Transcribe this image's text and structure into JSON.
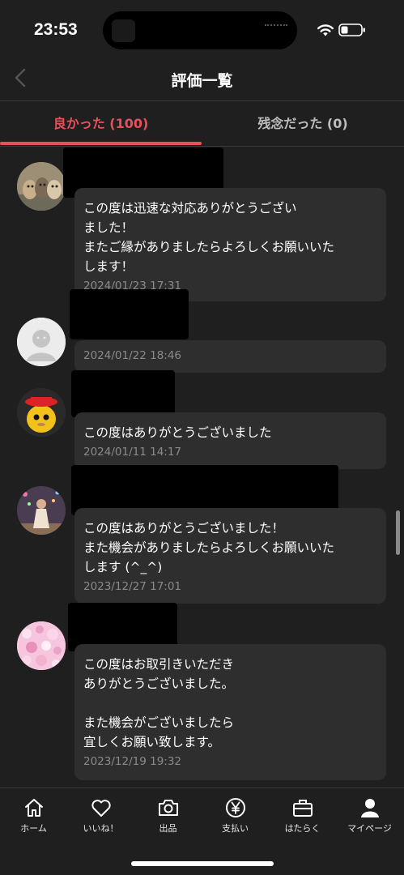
{
  "status_bar": {
    "time": "23:53"
  },
  "header": {
    "title": "評価一覧"
  },
  "tabs": [
    {
      "label": "良かった (100)",
      "active": true
    },
    {
      "label": "残念だった (0)",
      "active": false
    }
  ],
  "reviews": [
    {
      "comment": "この度は迅速な対応ありがとうござい\nました！\nまたご縁がありましたらよろしくお願いいた\nします！",
      "date": "2024/01/23 17:31",
      "avatar": "cats-avatar"
    },
    {
      "comment": "",
      "date": "2024/01/22 18:46",
      "avatar": "default-person-avatar"
    },
    {
      "comment": "この度はありがとうございました",
      "date": "2024/01/11 14:17",
      "avatar": "yellow-character-avatar"
    },
    {
      "comment": "この度はありがとうございました！\nまた機会がありましたらよろしくお願いいた\nします (^_^)",
      "date": "2023/12/27 17:01",
      "avatar": "person-photo-avatar"
    },
    {
      "comment": "この度はお取引きいただき\nありがとうございました。\n\nまた機会がございましたら\n宜しくお願い致します。",
      "date": "2023/12/19 19:32",
      "avatar": "pink-glitter-avatar"
    }
  ],
  "tabbar": {
    "items": [
      {
        "label": "ホーム",
        "icon": "home-icon"
      },
      {
        "label": "いいね！",
        "icon": "heart-icon"
      },
      {
        "label": "出品",
        "icon": "camera-icon"
      },
      {
        "label": "支払い",
        "icon": "yen-icon"
      },
      {
        "label": "はたらく",
        "icon": "briefcase-icon"
      },
      {
        "label": "マイページ",
        "icon": "person-icon"
      }
    ]
  },
  "colors": {
    "accent": "#e8505b",
    "background": "#1f1f1f",
    "bubble": "#2e2e2e"
  }
}
